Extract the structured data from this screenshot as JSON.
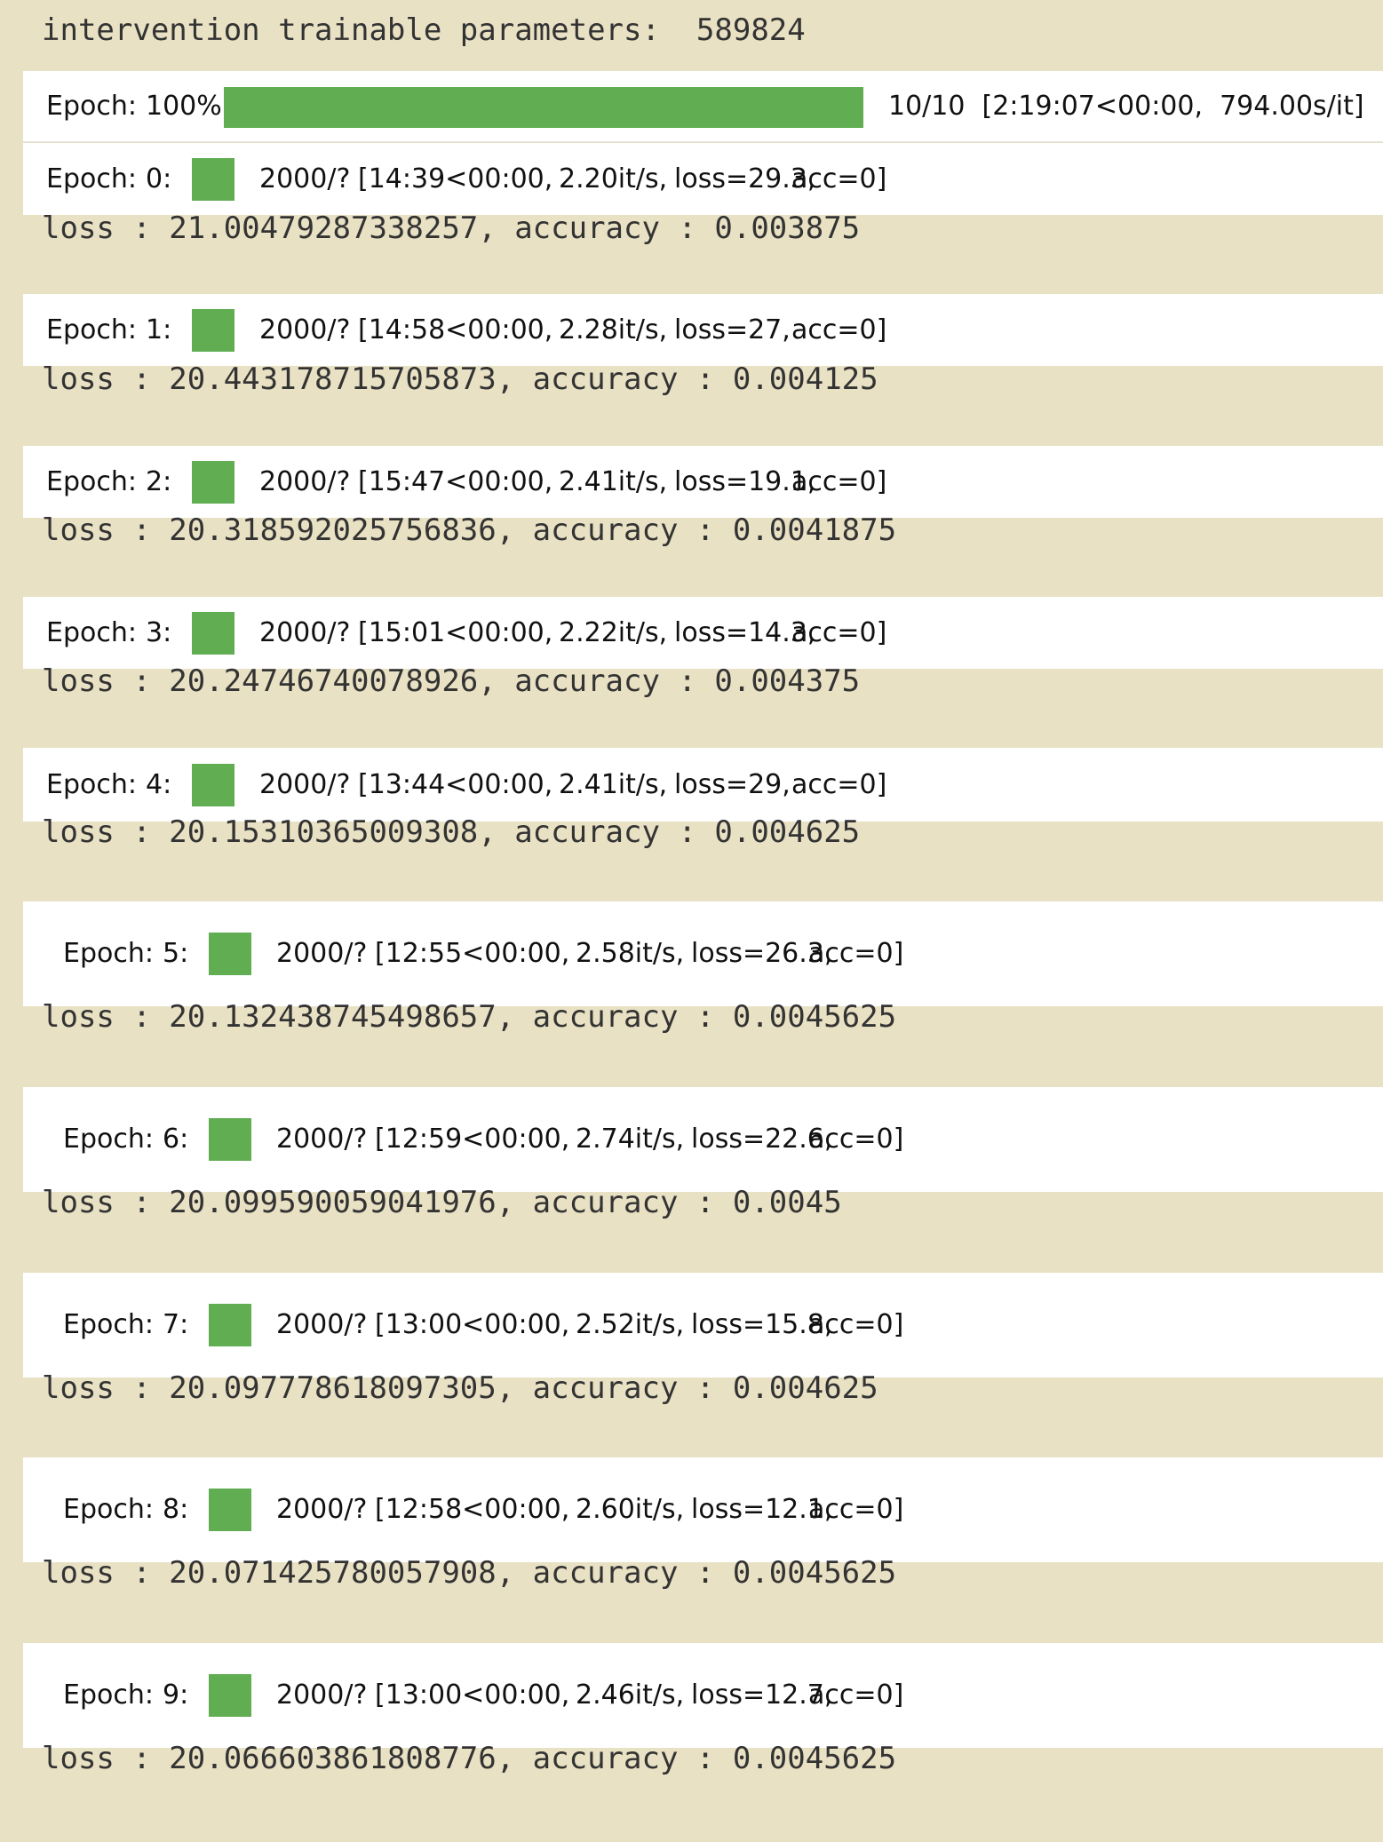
{
  "header": {
    "text": "intervention trainable parameters:  589824"
  },
  "overall": {
    "label": "Epoch:",
    "percent": "100%",
    "progress_fraction": 1.0,
    "status": "10/10  [2:19:07<00:00,  794.00s/it]"
  },
  "epochs": [
    {
      "label": "Epoch:",
      "num": "0:",
      "count": "2000/?",
      "timing": "[14:39<00:00,",
      "rate": "2.20it/s,",
      "loss": "loss=29.3,",
      "acc": "acc=0]",
      "result": "loss : 21.00479287338257, accuracy : 0.003875"
    },
    {
      "label": "Epoch:",
      "num": "1:",
      "count": "2000/?",
      "timing": "[14:58<00:00,",
      "rate": "2.28it/s,",
      "loss": "loss=27,",
      "acc": "acc=0]",
      "result": "loss : 20.443178715705873, accuracy : 0.004125"
    },
    {
      "label": "Epoch:",
      "num": "2:",
      "count": "2000/?",
      "timing": "[15:47<00:00,",
      "rate": "2.41it/s,",
      "loss": "loss=19.1,",
      "acc": "acc=0]",
      "result": "loss : 20.318592025756836, accuracy : 0.0041875"
    },
    {
      "label": "Epoch:",
      "num": "3:",
      "count": "2000/?",
      "timing": "[15:01<00:00,",
      "rate": "2.22it/s,",
      "loss": "loss=14.3,",
      "acc": "acc=0]",
      "result": "loss : 20.24746740078926, accuracy : 0.004375"
    },
    {
      "label": "Epoch:",
      "num": "4:",
      "count": "2000/?",
      "timing": "[13:44<00:00,",
      "rate": "2.41it/s,",
      "loss": "loss=29,",
      "acc": "acc=0]",
      "result": "loss : 20.15310365009308, accuracy : 0.004625"
    },
    {
      "label": "Epoch:",
      "num": "5:",
      "count": "2000/?",
      "timing": "[12:55<00:00,",
      "rate": "2.58it/s,",
      "loss": "loss=26.3,",
      "acc": "acc=0]",
      "result": "loss : 20.132438745498657, accuracy : 0.0045625"
    },
    {
      "label": "Epoch:",
      "num": "6:",
      "count": "2000/?",
      "timing": "[12:59<00:00,",
      "rate": "2.74it/s,",
      "loss": "loss=22.6,",
      "acc": "acc=0]",
      "result": "loss : 20.099590059041976, accuracy : 0.0045"
    },
    {
      "label": "Epoch:",
      "num": "7:",
      "count": "2000/?",
      "timing": "[13:00<00:00,",
      "rate": "2.52it/s,",
      "loss": "loss=15.8,",
      "acc": "acc=0]",
      "result": "loss : 20.097778618097305, accuracy : 0.004625"
    },
    {
      "label": "Epoch:",
      "num": "8:",
      "count": "2000/?",
      "timing": "[12:58<00:00,",
      "rate": "2.60it/s,",
      "loss": "loss=12.1,",
      "acc": "acc=0]",
      "result": "loss : 20.071425780057908, accuracy : 0.0045625"
    },
    {
      "label": "Epoch:",
      "num": "9:",
      "count": "2000/?",
      "timing": "[13:00<00:00,",
      "rate": "2.46it/s,",
      "loss": "loss=12.7,",
      "acc": "acc=0]",
      "result": "loss : 20.066603861808776, accuracy : 0.0045625"
    }
  ],
  "colors": {
    "background": "#e9e1c4",
    "progress": "#60ad52",
    "widget_bg": "#ffffff",
    "text": "#333333"
  }
}
